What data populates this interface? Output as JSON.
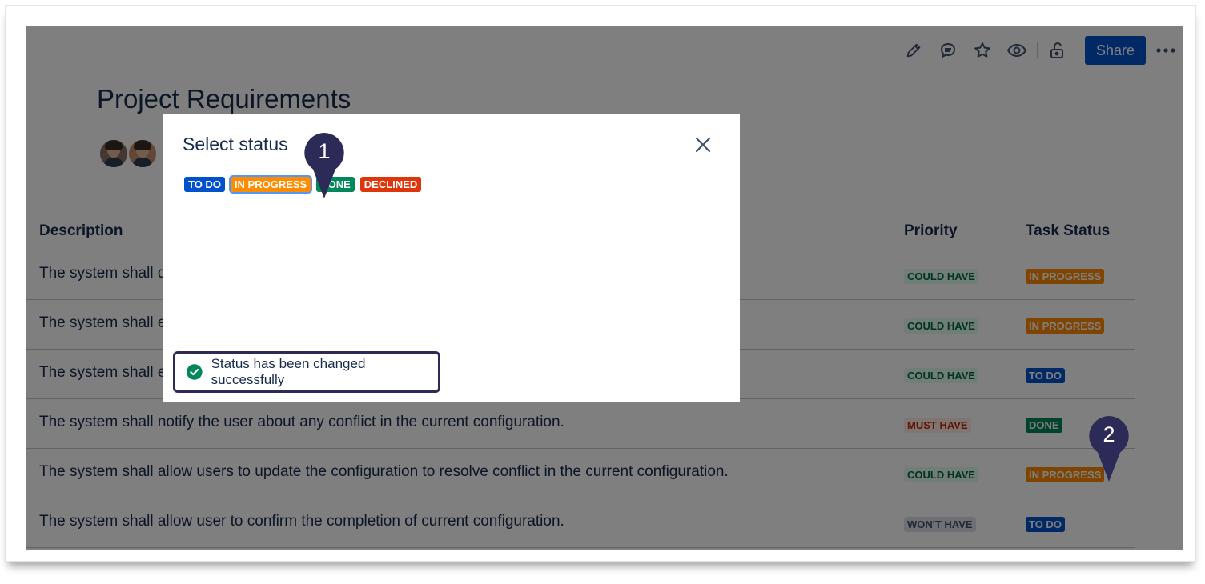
{
  "page": {
    "title": "Project Requirements",
    "share_label": "Share"
  },
  "toolbar": {
    "icons": [
      "pencil-icon",
      "comment-icon",
      "star-icon",
      "eye-icon",
      "unlock-icon",
      "more-icon"
    ]
  },
  "table": {
    "headers": {
      "description": "Description",
      "priority": "Priority",
      "task_status": "Task Status"
    },
    "rows": [
      {
        "description": "The system shall di",
        "priority": "COULD HAVE",
        "status": "IN PROGRESS"
      },
      {
        "description": "The system shall er",
        "priority": "COULD HAVE",
        "status": "IN PROGRESS"
      },
      {
        "description": "The system shall er",
        "priority": "COULD HAVE",
        "status": "TO DO"
      },
      {
        "description": "The system shall notify the user about any conflict in the current configuration.",
        "priority": "MUST HAVE",
        "status": "DONE"
      },
      {
        "description": "The system shall allow users to update the configuration to resolve conflict in the current configuration.",
        "priority": "COULD HAVE",
        "status": "IN PROGRESS"
      },
      {
        "description": "The system shall allow user to confirm the completion of current configuration.",
        "priority": "WON'T HAVE",
        "status": "TO DO"
      }
    ]
  },
  "dialog": {
    "title": "Select status",
    "options": [
      {
        "label": "TO DO",
        "color": "#0052cc"
      },
      {
        "label": "IN PROGRESS",
        "color": "#ff8b00",
        "selected": true
      },
      {
        "label": "DONE",
        "color": "#00875a"
      },
      {
        "label": "DECLINED",
        "color": "#de350b"
      }
    ],
    "toast": "Status has been changed successfully"
  },
  "callouts": {
    "first": "1",
    "second": "2"
  },
  "colors": {
    "brand": "#0052cc",
    "callout": "#2c2b58",
    "success": "#00875a"
  }
}
